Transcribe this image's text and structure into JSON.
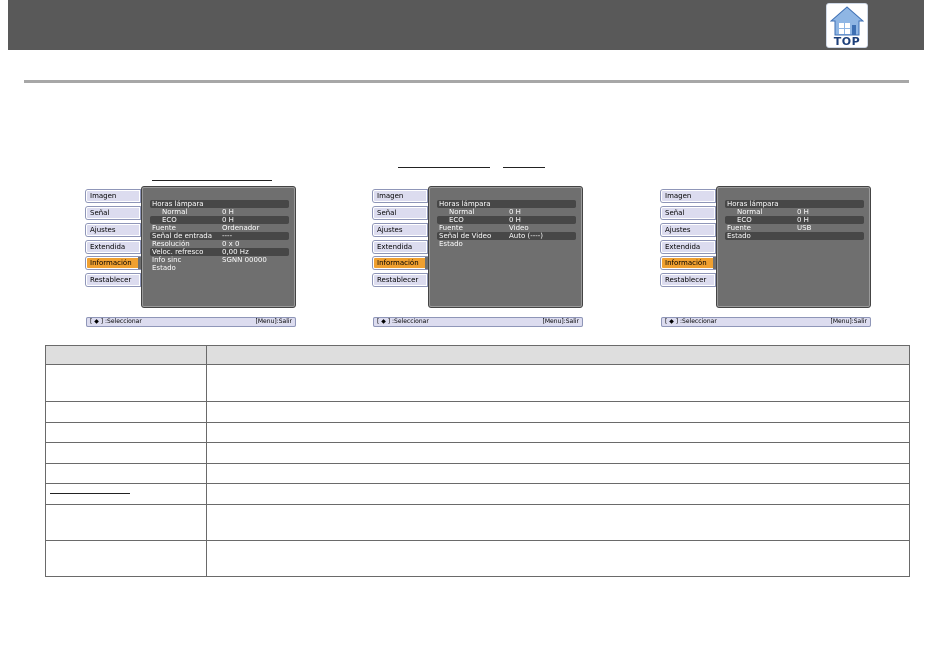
{
  "logo": {
    "text": "TOP"
  },
  "menu_tabs": [
    "Imagen",
    "Señal",
    "Ajustes",
    "Extendida",
    "Información",
    "Restablecer"
  ],
  "active_tab": "Información",
  "screens": [
    {
      "rows": [
        {
          "label": "Horas lámpara",
          "value": ""
        },
        {
          "label": "Normal",
          "value": "0  H",
          "sub": true
        },
        {
          "label": "ECO",
          "value": "0  H",
          "sub": true
        },
        {
          "label": "Fuente",
          "value": "Ordenador"
        },
        {
          "label": "Señal de entrada",
          "value": "----"
        },
        {
          "label": "Resolución",
          "value": "0    x      0"
        },
        {
          "label": "Veloc. refresco",
          "value": "0,00 Hz"
        },
        {
          "label": "Info sinc",
          "value": "SGNN 00000"
        },
        {
          "label": "Estado",
          "value": ""
        }
      ]
    },
    {
      "rows": [
        {
          "label": "Horas lámpara",
          "value": ""
        },
        {
          "label": "Normal",
          "value": "0  H",
          "sub": true
        },
        {
          "label": "ECO",
          "value": "0  H",
          "sub": true
        },
        {
          "label": "Fuente",
          "value": "Video"
        },
        {
          "label": "Señal de Video",
          "value": "Auto (----)"
        },
        {
          "label": "Estado",
          "value": ""
        }
      ]
    },
    {
      "rows": [
        {
          "label": "Horas lámpara",
          "value": ""
        },
        {
          "label": "Normal",
          "value": "0  H",
          "sub": true
        },
        {
          "label": "ECO",
          "value": "0  H",
          "sub": true
        },
        {
          "label": "Fuente",
          "value": "USB"
        },
        {
          "label": "Estado",
          "value": ""
        }
      ]
    }
  ],
  "bottom_bar": {
    "left": "[ ◆ ] :Seleccionar",
    "right": "[Menu]:Salir"
  }
}
